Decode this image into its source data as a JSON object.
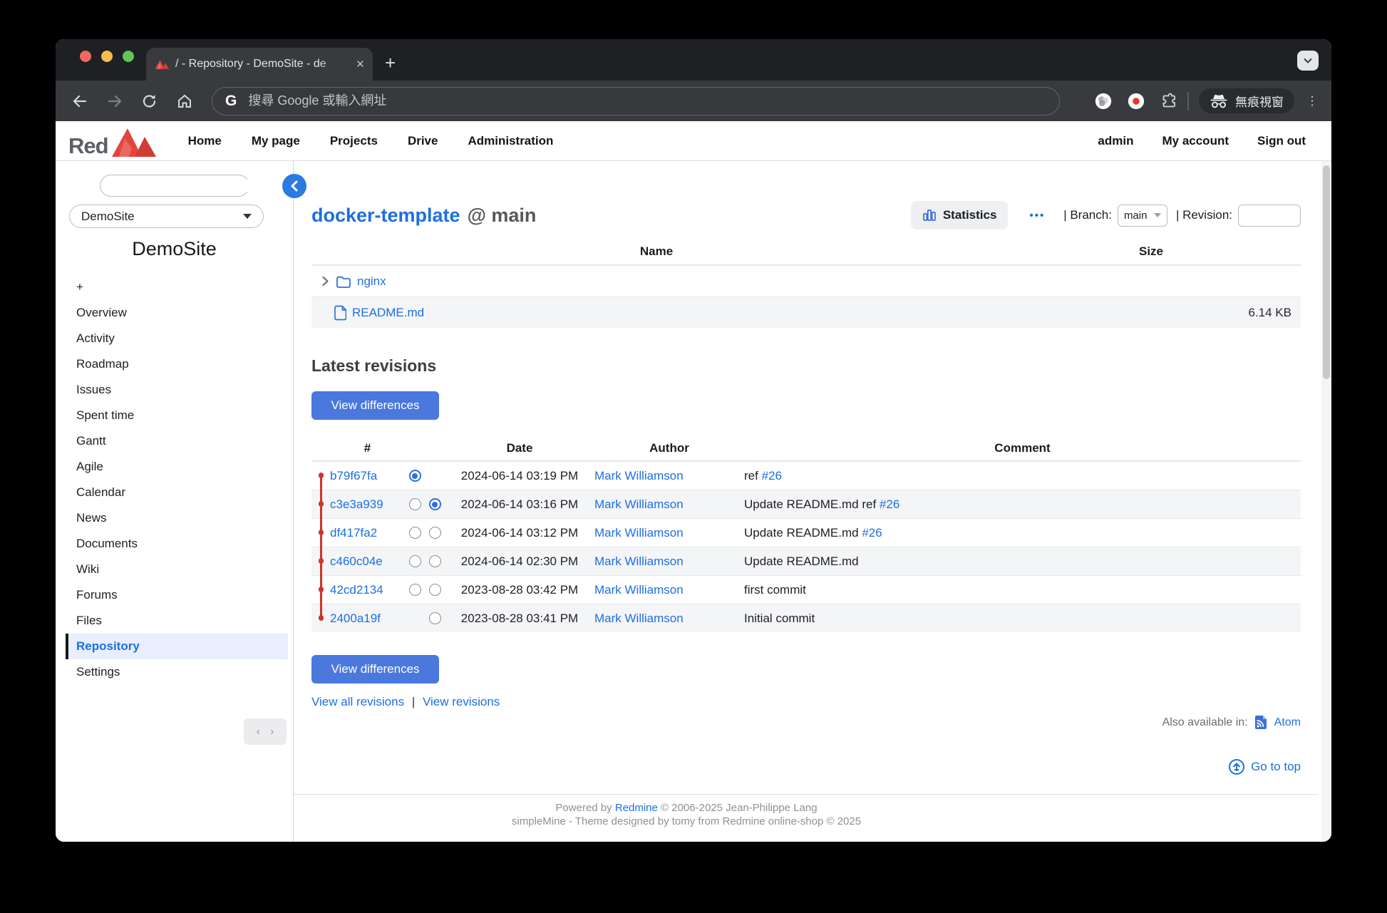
{
  "browser": {
    "tab_title": "/ - Repository - DemoSite - de",
    "tab_close": "×",
    "new_tab": "+",
    "strip_chevron": "˅",
    "url_placeholder": "搜尋 Google 或輸入網址",
    "g_logo": "G",
    "incognito_label": "無痕視窗",
    "kebab": "⋮"
  },
  "topnav": {
    "logo_text": "Red",
    "left": [
      "Home",
      "My page",
      "Projects",
      "Drive",
      "Administration"
    ],
    "right": [
      "admin",
      "My account",
      "Sign out"
    ]
  },
  "sidebar": {
    "project_select": "DemoSite",
    "project_title": "DemoSite",
    "items": [
      "+",
      "Overview",
      "Activity",
      "Roadmap",
      "Issues",
      "Spent time",
      "Gantt",
      "Agile",
      "Calendar",
      "News",
      "Documents",
      "Wiki",
      "Forums",
      "Files",
      "Repository",
      "Settings"
    ],
    "active_item": "Repository",
    "pager_prev": "‹",
    "pager_next": "›"
  },
  "repo": {
    "title": "docker-template",
    "at_branch": "@ main",
    "statistics_label": "Statistics",
    "more_label": "•••",
    "branch_label": "| Branch:",
    "branch_value": "main",
    "revision_label": "| Revision:"
  },
  "files": {
    "name_header": "Name",
    "size_header": "Size",
    "rows": [
      {
        "name": "nginx",
        "size": ""
      },
      {
        "name": "README.md",
        "size": "6.14 KB"
      }
    ]
  },
  "revisions": {
    "heading": "Latest revisions",
    "view_differences": "View differences",
    "headers": {
      "num": "#",
      "date": "Date",
      "author": "Author",
      "comment": "Comment"
    },
    "rows": [
      {
        "hash": "b79f67fa",
        "date": "2024-06-14 03:19 PM",
        "author": "Mark Williamson",
        "comment": "ref ",
        "comment_link": "#26"
      },
      {
        "hash": "c3e3a939",
        "date": "2024-06-14 03:16 PM",
        "author": "Mark Williamson",
        "comment": "Update README.md ref ",
        "comment_link": "#26"
      },
      {
        "hash": "df417fa2",
        "date": "2024-06-14 03:12 PM",
        "author": "Mark Williamson",
        "comment": "Update README.md ",
        "comment_link": "#26"
      },
      {
        "hash": "c460c04e",
        "date": "2024-06-14 02:30 PM",
        "author": "Mark Williamson",
        "comment": "Update README.md",
        "comment_link": ""
      },
      {
        "hash": "42cd2134",
        "date": "2023-08-28 03:42 PM",
        "author": "Mark Williamson",
        "comment": "first commit",
        "comment_link": ""
      },
      {
        "hash": "2400a19f",
        "date": "2023-08-28 03:41 PM",
        "author": "Mark Williamson",
        "comment": "Initial commit",
        "comment_link": ""
      }
    ],
    "view_all": "View all revisions",
    "links_sep": "|",
    "view_revisions": "View revisions"
  },
  "extras": {
    "also_available": "Also available in:",
    "atom_label": "Atom",
    "go_to_top": "Go to top"
  },
  "footer": {
    "line1_prefix": "Powered by ",
    "line1_link": "Redmine",
    "line1_suffix": " © 2006-2025 Jean-Philippe Lang",
    "line2": "simpleMine - Theme designed by tomy from Redmine online-shop © 2025"
  },
  "colors": {
    "link_blue": "#1d6fe0",
    "button_blue": "#4a78dc",
    "accent_red": "#d0342c",
    "active_item_bg": "#e8eefb",
    "chrome_dark": "#1f2023",
    "toolbar_dark": "#393a3e"
  }
}
